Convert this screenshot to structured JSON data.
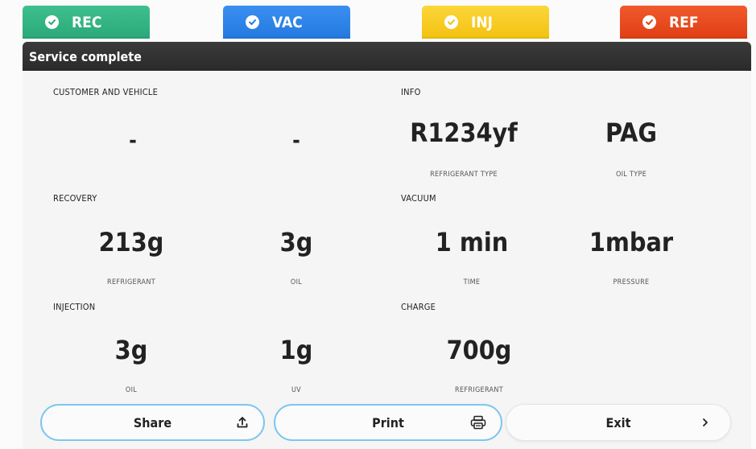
{
  "tabs": [
    {
      "label": "REC",
      "color": "#2aa879",
      "icon": "check-circle-icon"
    },
    {
      "label": "VAC",
      "color": "#2479e0",
      "icon": "check-circle-icon"
    },
    {
      "label": "INJ",
      "color": "#f3c111",
      "icon": "check-circle-icon"
    },
    {
      "label": "REF",
      "color": "#e03e14",
      "icon": "check-circle-icon"
    }
  ],
  "header": {
    "title": "Service complete"
  },
  "sections": {
    "customer": {
      "label": "CUSTOMER AND VEHICLE",
      "values": [
        "-",
        "-"
      ]
    },
    "info": {
      "label": "INFO",
      "refrigerant_type": {
        "value": "R1234yf",
        "caption": "REFRIGERANT TYPE"
      },
      "oil_type": {
        "value": "PAG",
        "caption": "OIL TYPE"
      }
    },
    "recovery": {
      "label": "RECOVERY",
      "refrigerant": {
        "value": "213g",
        "caption": "REFRIGERANT"
      },
      "oil": {
        "value": "3g",
        "caption": "OIL"
      }
    },
    "vacuum": {
      "label": "VACUUM",
      "time": {
        "value": "1 min",
        "caption": "TIME"
      },
      "pressure": {
        "value": "1mbar",
        "caption": "PRESSURE"
      }
    },
    "injection": {
      "label": "INJECTION",
      "oil": {
        "value": "3g",
        "caption": "OIL"
      },
      "uv": {
        "value": "1g",
        "caption": "UV"
      }
    },
    "charge": {
      "label": "CHARGE",
      "refrigerant": {
        "value": "700g",
        "caption": "REFRIGERANT"
      }
    }
  },
  "buttons": {
    "share": {
      "label": "Share",
      "icon": "upload-icon"
    },
    "print": {
      "label": "Print",
      "icon": "printer-icon"
    },
    "exit": {
      "label": "Exit",
      "icon": "chevron-right-icon"
    }
  }
}
